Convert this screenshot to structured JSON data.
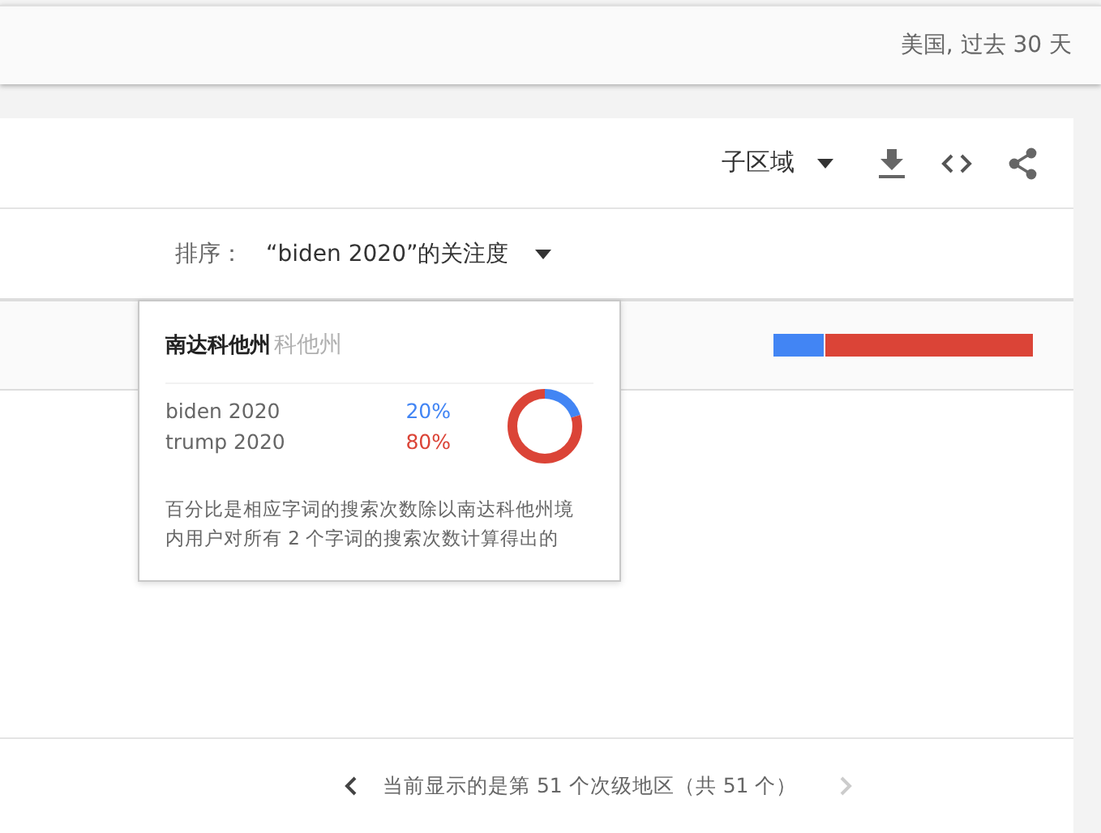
{
  "header": {
    "scope": "美国, 过去 30 天"
  },
  "card": {
    "region_dropdown": {
      "label": "子区域"
    },
    "sort": {
      "label": "排序：",
      "value": "“biden 2020”的关注度"
    },
    "rows": [
      {
        "label_visible": "科他州",
        "level": 0.2
      }
    ],
    "tooltip": {
      "title": "南达科他州",
      "terms": [
        {
          "name": "biden 2020",
          "value": "20%",
          "color": "#4285f4",
          "level": 0.2
        },
        {
          "name": "trump 2020",
          "value": "80%",
          "color": "#db4437",
          "level": 0.8
        }
      ],
      "note": "百分比是相应字词的搜索次数除以南达科他州境内用户对所有 2 个字词的搜索次数计算得出的"
    },
    "pagination": {
      "text": "当前显示的是第 51 个次级地区（共 51 个）",
      "prev_disabled": false,
      "next_disabled": true
    }
  }
}
